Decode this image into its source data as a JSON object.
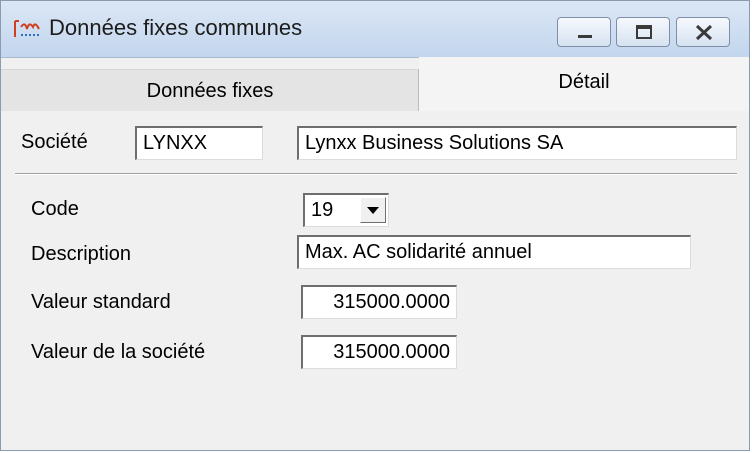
{
  "window": {
    "title": "Données fixes communes",
    "app_icon": "app-logo-icon",
    "controls": [
      "minimize-icon",
      "maximize-icon",
      "close-icon"
    ]
  },
  "tabs": [
    {
      "label": "Données fixes",
      "active": false
    },
    {
      "label": "Détail",
      "active": true
    }
  ],
  "company": {
    "label": "Société",
    "code": "LYNXX",
    "name": "Lynxx Business Solutions SA"
  },
  "detail": {
    "code_label": "Code",
    "code_value": "19",
    "description_label": "Description",
    "description_value": "Max. AC solidarité annuel",
    "standard_label": "Valeur standard",
    "standard_value": "315000.0000",
    "company_value_label": "Valeur de la société",
    "company_value": "315000.0000"
  },
  "colors": {
    "titlebar": "#c3d6ee",
    "panel": "#f0f0f0",
    "field": "#ffffff"
  }
}
